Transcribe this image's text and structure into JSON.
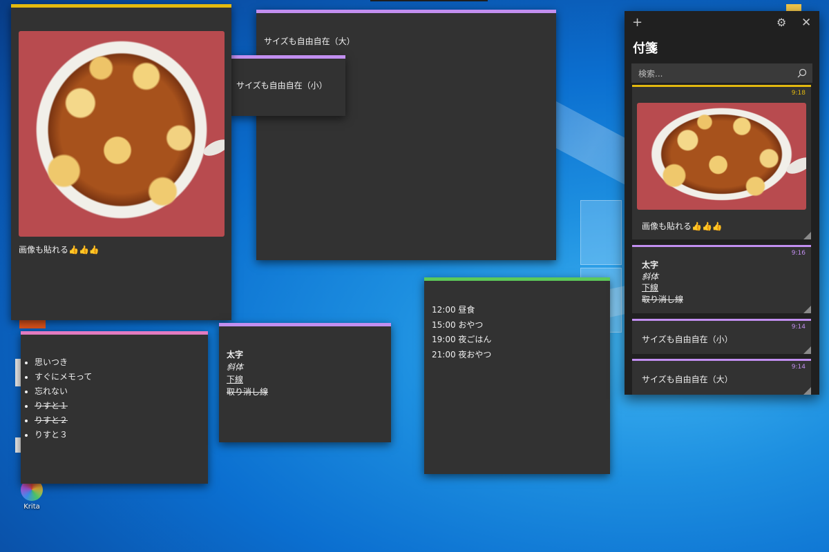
{
  "colors": {
    "yellow": "#e3b90f",
    "purple": "#c28ff0",
    "pink": "#e27bc0",
    "green": "#5cc95a",
    "note_bg": "#323232",
    "panel_bg": "#202020"
  },
  "desktop": {
    "icons": [
      {
        "label": "Krita",
        "icon": "krita-icon"
      }
    ]
  },
  "notes": {
    "image_note": {
      "caption": "画像も貼れる👍👍👍",
      "image": "mapo-tofu-photo"
    },
    "large_note": {
      "text": "サイズも自由自在（大）"
    },
    "small_note": {
      "text": "サイズも自由自在（小）"
    },
    "list_note": {
      "items": [
        {
          "text": "思いつき"
        },
        {
          "text": "すぐにメモって"
        },
        {
          "text": "忘れない"
        },
        {
          "text": "りすと１",
          "strike": true
        },
        {
          "text": "りすと２",
          "strike": true
        },
        {
          "text": "りすと３"
        }
      ]
    },
    "format_note": {
      "bold": "太字",
      "italic": "斜体",
      "underline": "下線",
      "strike": "取り消し線"
    },
    "schedule_note": {
      "lines": [
        "12:00 昼食",
        "15:00 おやつ",
        "19:00 夜ごはん",
        "21:00 夜おやつ"
      ]
    }
  },
  "panel": {
    "add_icon": "plus-icon",
    "settings_icon": "gear-icon",
    "close_icon": "close-icon",
    "title": "付箋",
    "search_placeholder": "検索...",
    "search_icon": "search-icon",
    "cards": [
      {
        "time": "9:18",
        "color": "yellow",
        "caption": "画像も貼れる👍👍👍",
        "image": "mapo-tofu-photo"
      },
      {
        "time": "9:16",
        "color": "purple",
        "bold": "太字",
        "italic": "斜体",
        "underline": "下線",
        "strike": "取り消し線"
      },
      {
        "time": "9:14",
        "color": "purple",
        "text": "サイズも自由自在（小）"
      },
      {
        "time": "9:14",
        "color": "purple",
        "text": "サイズも自由自在（大）"
      }
    ]
  }
}
